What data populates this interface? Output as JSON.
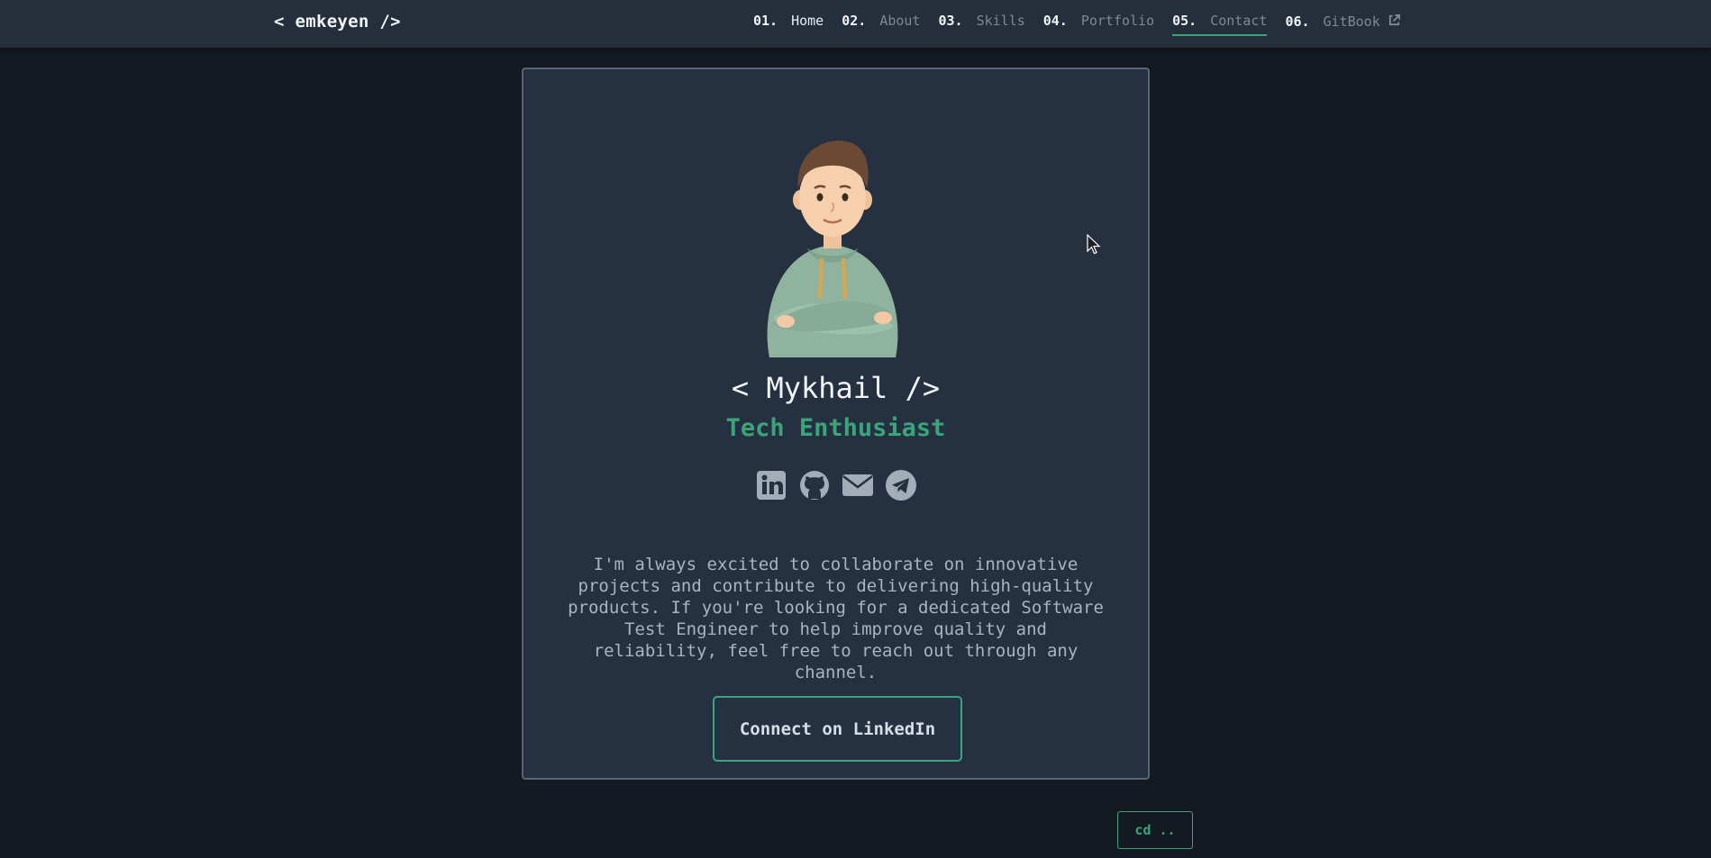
{
  "header": {
    "logo": "< emkeyen />",
    "nav": [
      {
        "num": "01.",
        "label": "Home"
      },
      {
        "num": "02.",
        "label": "About"
      },
      {
        "num": "03.",
        "label": "Skills"
      },
      {
        "num": "04.",
        "label": "Portfolio"
      },
      {
        "num": "05.",
        "label": "Contact",
        "active": true
      },
      {
        "num": "06.",
        "label": "GitBook",
        "icon": "external-link-icon"
      }
    ]
  },
  "profile": {
    "name": "< Mykhail />",
    "role": "Tech Enthusiast",
    "socials": [
      "linkedin-icon",
      "github-icon",
      "email-icon",
      "telegram-icon"
    ],
    "bio": "I'm always excited to collaborate on innovative projects and contribute to delivering high-quality products. If you're looking for a dedicated Software Test Engineer to help improve quality and reliability, feel free to reach out through any channel.",
    "cta_label": "Connect on LinkedIn"
  },
  "footer": {
    "back_label": "cd .."
  },
  "colors": {
    "background": "#151a22",
    "navbar": "#252f3b",
    "card": "#253140",
    "accent": "#3aa57a"
  }
}
